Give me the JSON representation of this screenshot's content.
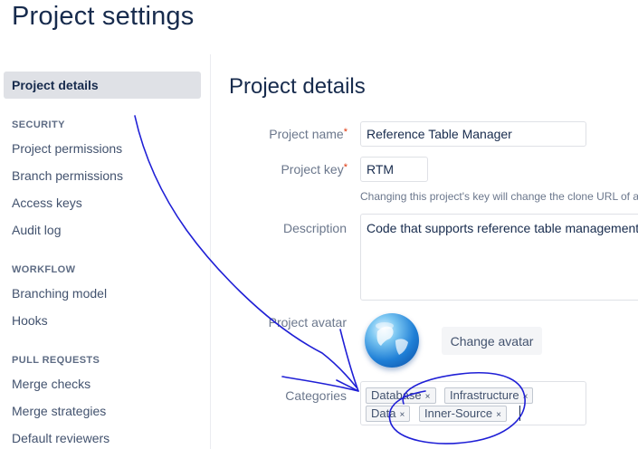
{
  "page": {
    "title": "Project settings"
  },
  "sidebar": {
    "active_item": "Project details",
    "sections": [
      {
        "heading": "SECURITY",
        "items": [
          "Project permissions",
          "Branch permissions",
          "Access keys",
          "Audit log"
        ]
      },
      {
        "heading": "WORKFLOW",
        "items": [
          "Branching model",
          "Hooks"
        ]
      },
      {
        "heading": "PULL REQUESTS",
        "items": [
          "Merge checks",
          "Merge strategies",
          "Default reviewers"
        ]
      }
    ]
  },
  "main": {
    "title": "Project details",
    "project_name": {
      "label": "Project name",
      "required_mark": "*",
      "value": "Reference Table Manager"
    },
    "project_key": {
      "label": "Project key",
      "required_mark": "*",
      "value": "RTM",
      "help": "Changing this project's key will change the clone URL of al"
    },
    "description": {
      "label": "Description",
      "value": "Code that supports reference table management"
    },
    "avatar": {
      "label": "Project avatar",
      "icon": "globe-icon",
      "button": "Change avatar"
    },
    "categories": {
      "label": "Categories",
      "remove_glyph": "×",
      "tags": [
        "Database",
        "Infrastructure",
        "Data",
        "Inner-Source"
      ]
    }
  },
  "annotation": {
    "color": "#1f1fd6"
  }
}
